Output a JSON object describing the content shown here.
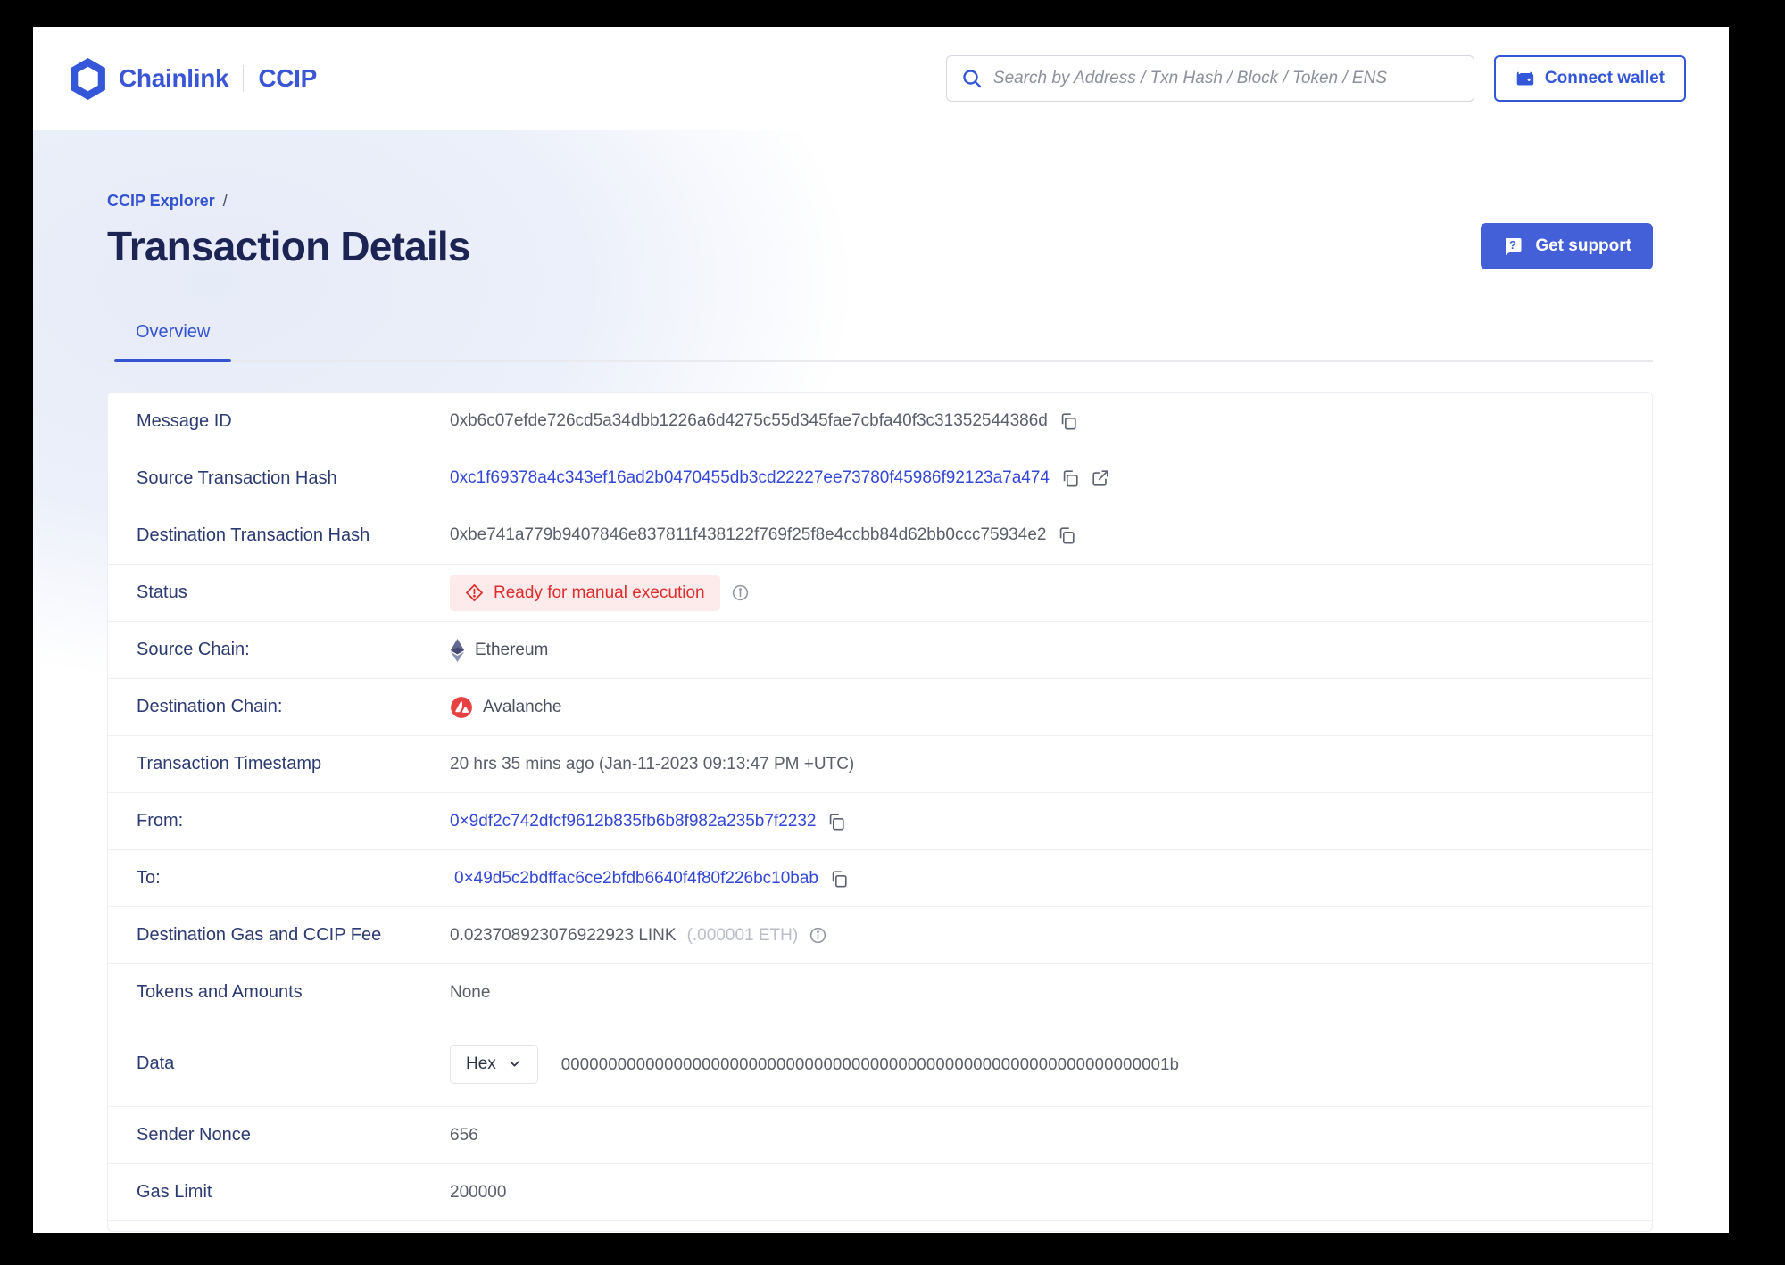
{
  "theme": {
    "accent_blue": "#3357d8",
    "link_blue": "#3347d6",
    "title_navy": "#1c2454",
    "label_navy": "#2b3a71",
    "value_gray": "#595e6a",
    "muted_gray": "#b9bdc7",
    "status_red": "#dd2d2d",
    "status_bg": "#fcebea",
    "ethereum_slate": "#62688f",
    "avalanche_red": "#e84142"
  },
  "header": {
    "brand": {
      "name": "Chainlink",
      "product": "CCIP"
    },
    "search_placeholder": "Search by Address / Txn Hash / Block / Token / ENS",
    "connect_wallet_label": "Connect wallet"
  },
  "hero": {
    "breadcrumb": "CCIP Explorer",
    "breadcrumb_separator": "/",
    "title": "Transaction Details",
    "get_support_label": "Get support",
    "tab_overview": "Overview"
  },
  "details": {
    "rows": [
      {
        "label": "Message ID",
        "value": "0xb6c07efde726cd5a34dbb1226a6d4275c55d345fae7cbfa40f3c31352544386d"
      },
      {
        "label": "Source Transaction Hash",
        "value": "0xc1f69378a4c343ef16ad2b0470455db3cd22227ee73780f45986f92123a7a474"
      },
      {
        "label": "Destination Transaction Hash",
        "value": "0xbe741a779b9407846e837811f438122f769f25f8e4ccbb84d62bb0ccc75934e2"
      },
      {
        "label": "Status",
        "value": "Ready for manual execution"
      },
      {
        "label": "Source Chain:",
        "value": "Ethereum"
      },
      {
        "label": "Destination Chain:",
        "value": "Avalanche"
      },
      {
        "label": "Transaction Timestamp",
        "value": "20 hrs 35 mins ago (Jan-11-2023 09:13:47 PM +UTC)"
      },
      {
        "label": "From:",
        "value": "0×9df2c742dfcf9612b835fb6b8f982a235b7f2232"
      },
      {
        "label": "To:",
        "value": "0×49d5c2bdffac6ce2bfdb6640f4f80f226bc10bab"
      },
      {
        "label": "Destination Gas and CCIP Fee",
        "value": "0.023708923076922923 LINK",
        "value_secondary": "(.000001 ETH)"
      },
      {
        "label": "Tokens and Amounts",
        "value": "None"
      },
      {
        "label": "Data",
        "format_label": "Hex",
        "value": "00000000000000000000000000000000000000000000000000000000000000001b"
      },
      {
        "label": "Sender Nonce",
        "value": "656"
      },
      {
        "label": "Gas Limit",
        "value": "200000"
      }
    ]
  }
}
